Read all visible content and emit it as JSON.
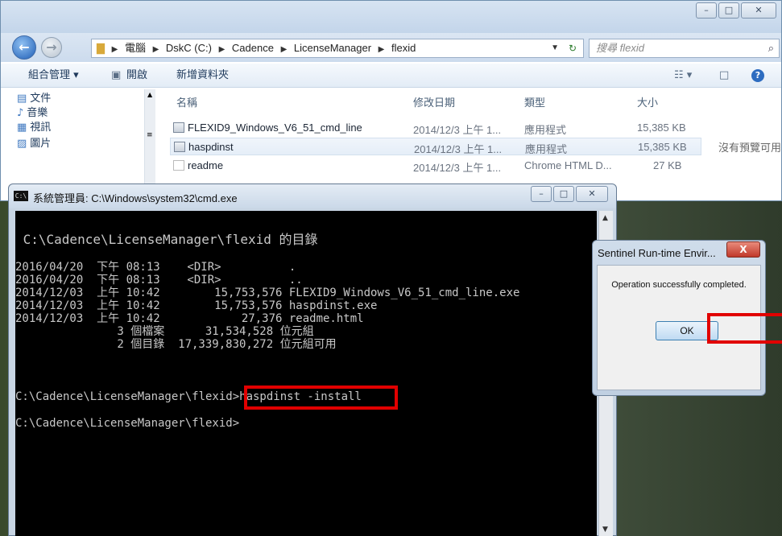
{
  "explorer": {
    "address": [
      "電腦",
      "DskC (C:)",
      "Cadence",
      "LicenseManager",
      "flexid"
    ],
    "search_placeholder": "搜尋 flexid",
    "toolbar": {
      "organize": "組合管理 ▾",
      "open": "開啟",
      "new_folder": "新增資料夾"
    },
    "sidebar": [
      "文件",
      "音樂",
      "視訊",
      "圖片"
    ],
    "columns": {
      "name": "名稱",
      "date": "修改日期",
      "type": "類型",
      "size": "大小"
    },
    "files": [
      {
        "name": "FLEXID9_Windows_V6_51_cmd_line",
        "date": "2014/12/3 上午 1...",
        "type": "應用程式",
        "size": "15,385 KB"
      },
      {
        "name": "haspdinst",
        "date": "2014/12/3 上午 1...",
        "type": "應用程式",
        "size": "15,385 KB"
      },
      {
        "name": "readme",
        "date": "2014/12/3 上午 1...",
        "type": "Chrome HTML D...",
        "size": "27 KB"
      }
    ],
    "preview_text": "沒有預覽可用"
  },
  "cmd": {
    "icon_text": "C:\\",
    "title": "系統管理員: C:\\Windows\\system32\\cmd.exe",
    "lines": [
      " C:\\Cadence\\LicenseManager\\flexid 的目錄",
      "",
      "2016/04/20  下午 08:13    <DIR>          .",
      "2016/04/20  下午 08:13    <DIR>          ..",
      "2014/12/03  上午 10:42        15,753,576 FLEXID9_Windows_V6_51_cmd_line.exe",
      "2014/12/03  上午 10:42        15,753,576 haspdinst.exe",
      "2014/12/03  上午 10:42            27,376 readme.html",
      "               3 個檔案      31,534,528 位元組",
      "               2 個目錄  17,339,830,272 位元組可用",
      "",
      "C:\\Cadence\\LicenseManager\\flexid>haspdinst -install",
      "",
      "C:\\Cadence\\LicenseManager\\flexid>"
    ]
  },
  "dialog": {
    "title": "Sentinel Run-time Envir...",
    "close_label": "X",
    "message": "Operation successfully completed.",
    "ok_label": "OK"
  },
  "colors": {
    "highlight": "#e10000",
    "console_bg": "#000000",
    "console_fg": "#c8c8c8"
  }
}
